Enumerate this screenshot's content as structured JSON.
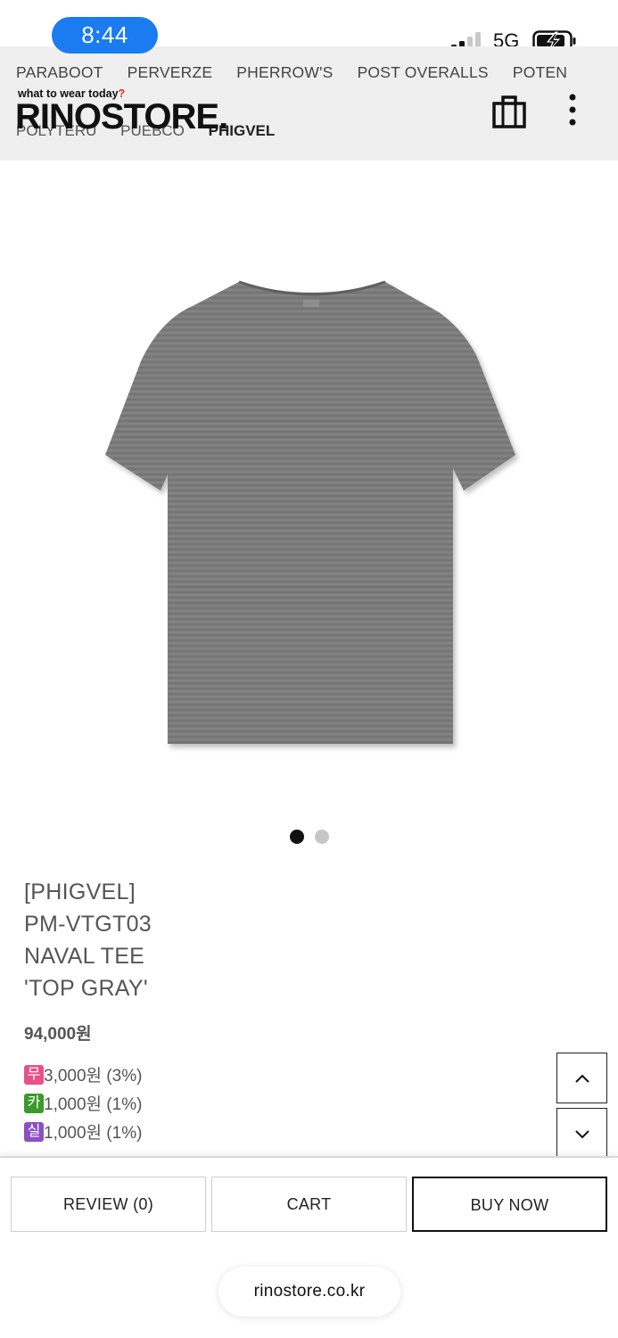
{
  "status_bar": {
    "time": "8:44",
    "network": "5G",
    "time_pill_color": "#1a7cf0"
  },
  "header": {
    "brand_row1": [
      "PARABOOT",
      "PERVERZE",
      "PHERROW'S",
      "POST OVERALLS",
      "POTEN"
    ],
    "brand_row2": [
      "POLYTERU",
      "PUEBCO",
      "PHIGVEL"
    ],
    "active_brand": "PHIGVEL",
    "tagline": "what to wear today",
    "tagline_mark": "?",
    "logo": "RINOSTORE."
  },
  "carousel": {
    "total": 2,
    "active_index": 0
  },
  "product": {
    "title_lines": [
      "[PHIGVEL]",
      "PM-VTGT03",
      "NAVAL TEE",
      "'TOP GRAY'"
    ],
    "price": "94,000원",
    "points": [
      {
        "badge": "무",
        "badge_color": "#e8508a",
        "text": "3,000원 (3%)"
      },
      {
        "badge": "카",
        "badge_color": "#3a9a2a",
        "text": "1,000원 (1%)"
      },
      {
        "badge": "실",
        "badge_color": "#8a4fc4",
        "text": "1,000원 (1%)"
      }
    ]
  },
  "actions": {
    "review": "REVIEW (0)",
    "cart": "CART",
    "buy_now": "BUY NOW"
  },
  "browser": {
    "url": "rinostore.co.kr"
  },
  "icons": {
    "bag": "shopping-bag-icon",
    "menu": "more-vertical-icon",
    "up": "chevron-up-icon",
    "down": "chevron-down-icon"
  }
}
